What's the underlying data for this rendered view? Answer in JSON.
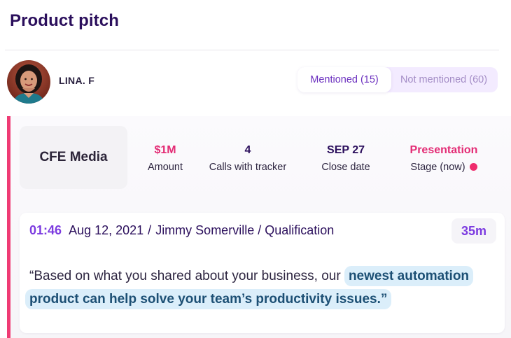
{
  "page": {
    "title": "Product pitch"
  },
  "user": {
    "name": "LINA. F",
    "avatar": "avatar-photo"
  },
  "filter": {
    "mentioned_label": "Mentioned (15)",
    "not_mentioned_label": "Not mentioned (60)",
    "active": "mentioned"
  },
  "deal": {
    "company": "CFE Media",
    "stats": [
      {
        "value": "$1M",
        "label": "Amount"
      },
      {
        "value": "4",
        "label": "Calls with tracker"
      },
      {
        "value": "SEP 27",
        "label": "Close date"
      },
      {
        "value": "Presentation",
        "label": "Stage (now)"
      }
    ]
  },
  "call": {
    "time": "01:46",
    "date": "Aug 12, 2021",
    "separator": "/",
    "person": "Jimmy Somerville",
    "stage": "/ Qualification",
    "duration": "35m",
    "quote_plain": "“Based on what you shared about your business, our ",
    "quote_highlight": "newest automation product can help solve your team’s productivity issues.”"
  },
  "colors": {
    "accent": "#ef3b74",
    "brand_purple": "#7c3be0",
    "title": "#2b0f5c",
    "highlight_bg": "#dbeefa"
  },
  "icons": {
    "stage_status": "status-dot-icon"
  }
}
